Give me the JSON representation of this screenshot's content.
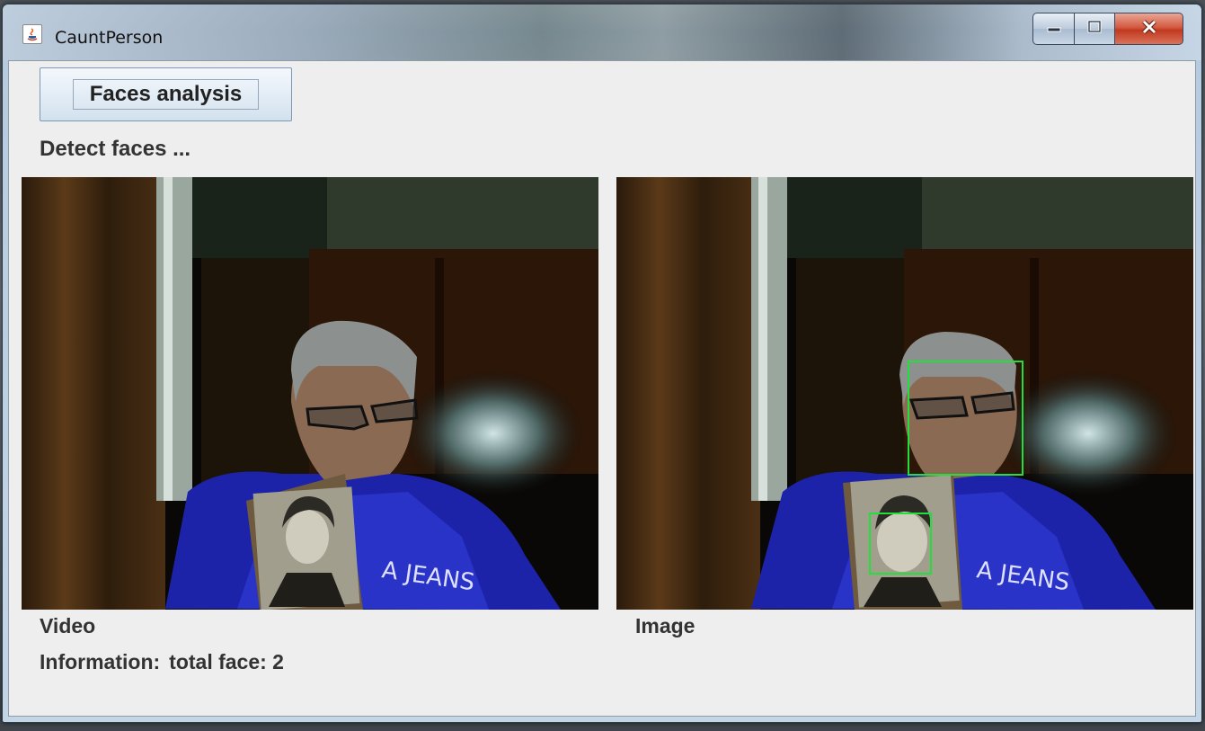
{
  "window": {
    "title": "CauntPerson",
    "controls": {
      "minimize": "minimize-icon",
      "maximize": "maximize-icon",
      "close": "close-icon"
    }
  },
  "toolbar": {
    "analysis_label": "Faces analysis"
  },
  "status_text": "Detect faces ...",
  "panels": {
    "video_caption": "Video",
    "image_caption": "Image"
  },
  "info": {
    "label": "Information:",
    "value": "total face: 2"
  },
  "colors": {
    "detection_box": "#22e03a",
    "shirt": "#2a33c8",
    "background_panel": "#050505"
  }
}
